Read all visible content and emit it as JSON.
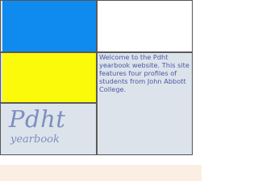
{
  "logo": {
    "title": "Pdht",
    "subtitle": "yearbook"
  },
  "intro": {
    "text": "Welcome to the Pdht yearbook website. This site features four profiles of students from John Abbott College."
  },
  "colors": {
    "blue_panel": "#0f8bf0",
    "yellow_panel": "#fafa0a",
    "content_background": "#dde3ea",
    "text_color": "#4a58a8",
    "logo_color": "#7b8fc1",
    "footer_band": "#fbeee2"
  }
}
